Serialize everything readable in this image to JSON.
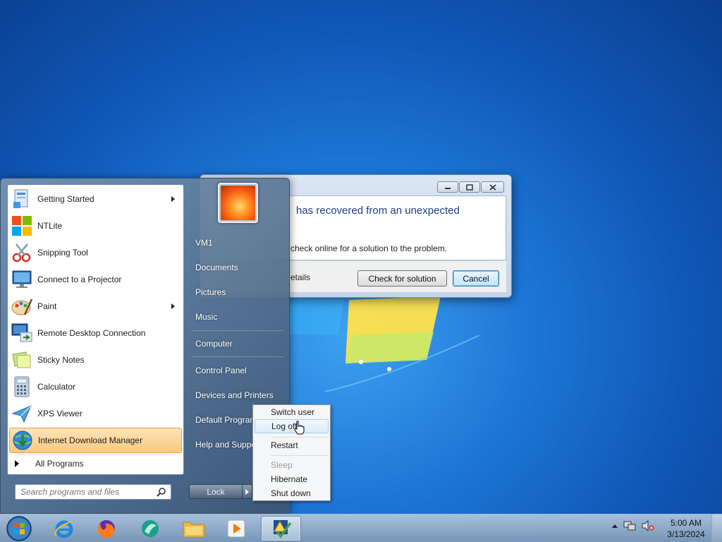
{
  "desktop": {
    "colors": {
      "background": "#1d76d6",
      "accent": "#f9c980"
    }
  },
  "dialog": {
    "headline": "has recovered from an unexpected",
    "message": "check online for a solution to the problem.",
    "details_label": "etails",
    "check_button": "Check for solution",
    "cancel_button": "Cancel",
    "window_buttons": [
      "minimize-icon",
      "restore-icon",
      "close-icon"
    ]
  },
  "start_menu": {
    "programs": [
      {
        "label": "Getting Started",
        "icon": "getting-started-icon",
        "submenu": true
      },
      {
        "label": "NTLite",
        "icon": "ntlite-icon",
        "submenu": false
      },
      {
        "label": "Snipping Tool",
        "icon": "snipping-tool-icon",
        "submenu": false
      },
      {
        "label": "Connect to a Projector",
        "icon": "projector-icon",
        "submenu": false
      },
      {
        "label": "Paint",
        "icon": "paint-icon",
        "submenu": true
      },
      {
        "label": "Remote Desktop Connection",
        "icon": "remote-desktop-icon",
        "submenu": false
      },
      {
        "label": "Sticky Notes",
        "icon": "sticky-notes-icon",
        "submenu": false
      },
      {
        "label": "Calculator",
        "icon": "calculator-icon",
        "submenu": false
      },
      {
        "label": "XPS Viewer",
        "icon": "xps-viewer-icon",
        "submenu": false
      },
      {
        "label": "Internet Download Manager",
        "icon": "idm-icon",
        "submenu": false,
        "highlighted": true
      }
    ],
    "all_programs": "All Programs",
    "search_placeholder": "Search programs and files",
    "right_links": {
      "user": "VM1",
      "documents": "Documents",
      "pictures": "Pictures",
      "music": "Music",
      "computer": "Computer",
      "control_panel": "Control Panel",
      "devices": "Devices and Printers",
      "default_programs": "Default Programs",
      "help": "Help and Support"
    },
    "lock_button": "Lock"
  },
  "power_menu": {
    "switch_user": "Switch user",
    "log_off": "Log off",
    "restart": "Restart",
    "sleep": "Sleep",
    "hibernate": "Hibernate",
    "shut_down": "Shut down"
  },
  "taskbar": {
    "apps": [
      "internet-explorer-icon",
      "firefox-icon",
      "app-icon",
      "file-explorer-icon",
      "media-player-icon",
      "active-app-icon"
    ],
    "clock_time": "5:00 AM",
    "clock_date": "3/13/2024"
  }
}
